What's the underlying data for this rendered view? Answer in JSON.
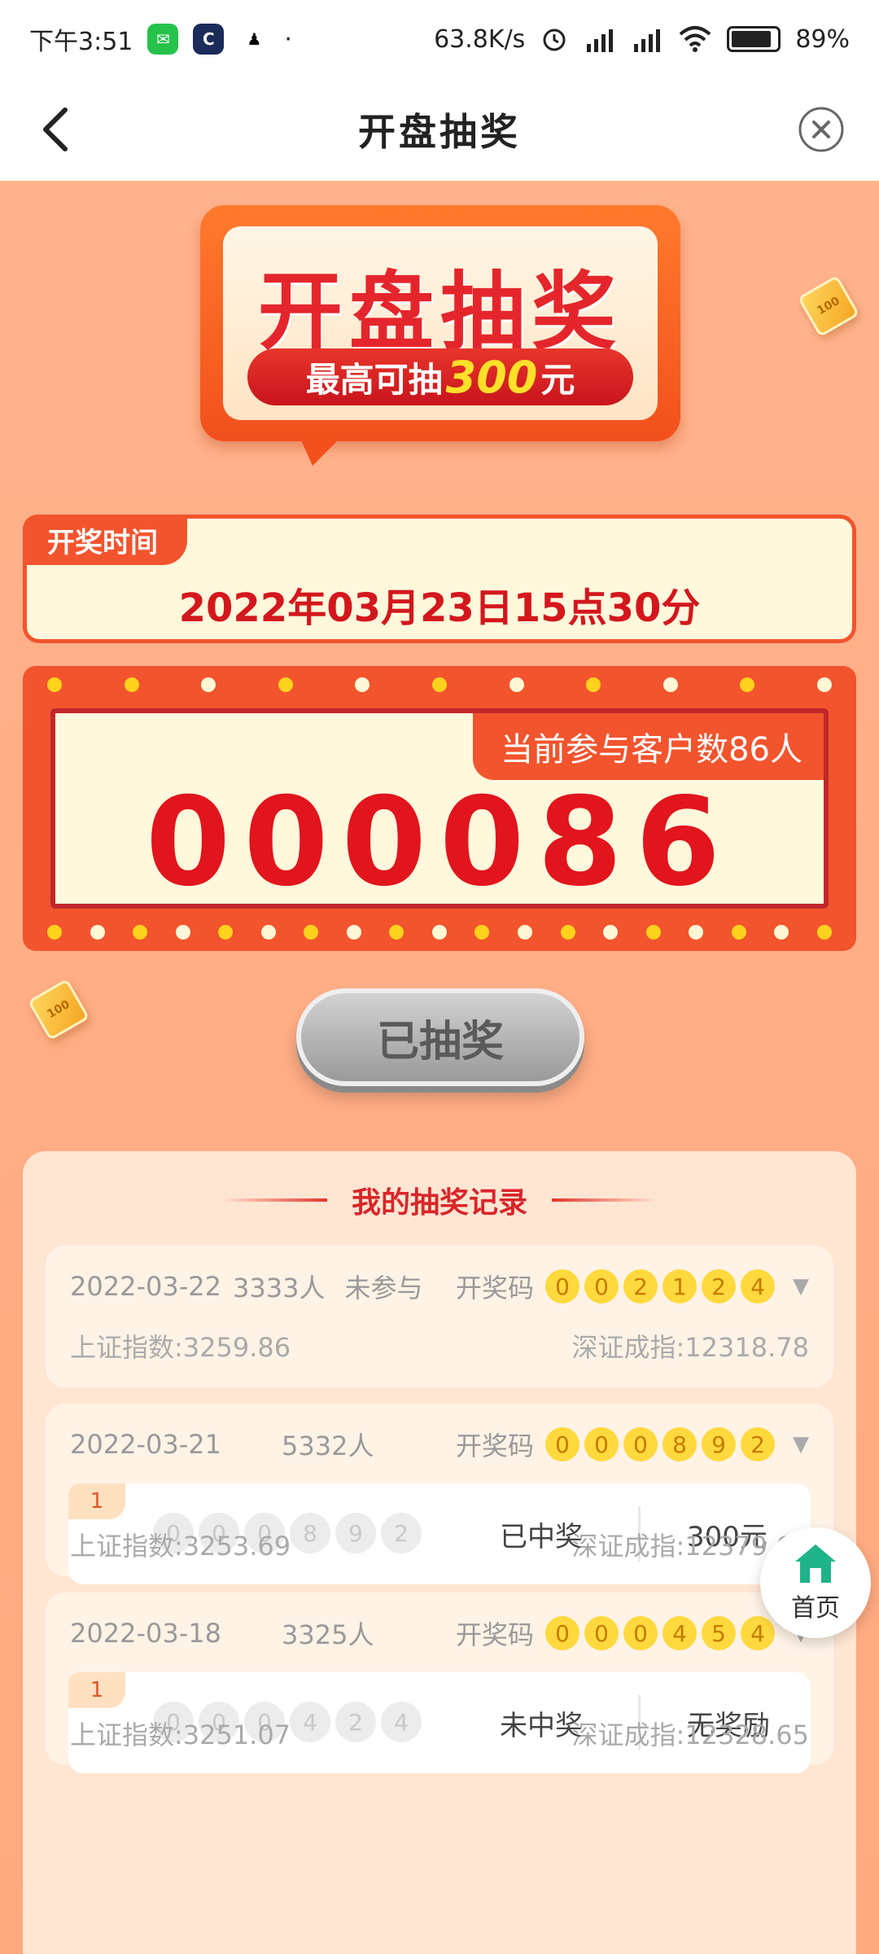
{
  "status_bar": {
    "time": "下午3:51",
    "dot": "·",
    "net_speed": "63.8K/s",
    "battery": "89%",
    "icons": [
      "wechat-icon",
      "cc-icon",
      "qq-icon",
      "alarm-icon",
      "hd-signal-icon",
      "hd-signal-icon",
      "wifi-icon",
      "battery-icon"
    ]
  },
  "header": {
    "title": "开盘抽奖",
    "back_icon": "chevron-left-icon",
    "close_icon": "close-circle-icon"
  },
  "banner": {
    "title": "开盘抽奖",
    "subtitle_prefix": "最高可抽",
    "subtitle_amount": "300",
    "subtitle_suffix": "元"
  },
  "draw_time": {
    "label": "开奖时间",
    "value": "2022年03月23日15点30分"
  },
  "counter": {
    "participants_label": "当前参与客户数86人",
    "number": "000086"
  },
  "action": {
    "drawn_label": "已抽奖"
  },
  "records": {
    "title": "我的抽奖记录",
    "items": [
      {
        "date": "2022-03-22",
        "count": "3333人",
        "status": "未参与",
        "code_label": "开奖码",
        "code": [
          "0",
          "0",
          "2",
          "1",
          "2",
          "4"
        ],
        "shanghai": "上证指数:3259.86",
        "shenzhen": "深证成指:12318.78"
      },
      {
        "date": "2022-03-21",
        "count": "5332人",
        "status": "",
        "code_label": "开奖码",
        "code": [
          "0",
          "0",
          "0",
          "8",
          "9",
          "2"
        ],
        "entry": {
          "tag": "1",
          "numbers": [
            "0",
            "0",
            "0",
            "8",
            "9",
            "2"
          ],
          "result": "已中奖",
          "reward": "300元"
        },
        "shanghai": "上证指数:3253.69",
        "shenzhen": "深证成指:12379.64"
      },
      {
        "date": "2022-03-18",
        "count": "3325人",
        "status": "",
        "code_label": "开奖码",
        "code": [
          "0",
          "0",
          "0",
          "4",
          "5",
          "4"
        ],
        "entry": {
          "tag": "1",
          "numbers": [
            "0",
            "0",
            "0",
            "4",
            "2",
            "4"
          ],
          "result": "未中奖",
          "reward": "无奖励"
        },
        "shanghai": "上证指数:3251.07",
        "shenzhen": "深证成指:12328.65"
      }
    ]
  },
  "fab": {
    "label": "首页",
    "icon": "home-icon"
  },
  "colors": {
    "accent_red": "#e2141d",
    "orange": "#f2542d",
    "background": "#ffae86",
    "cream": "#fff8dc",
    "ball_yellow": "#ffd93d",
    "home_green": "#1fb38a"
  }
}
